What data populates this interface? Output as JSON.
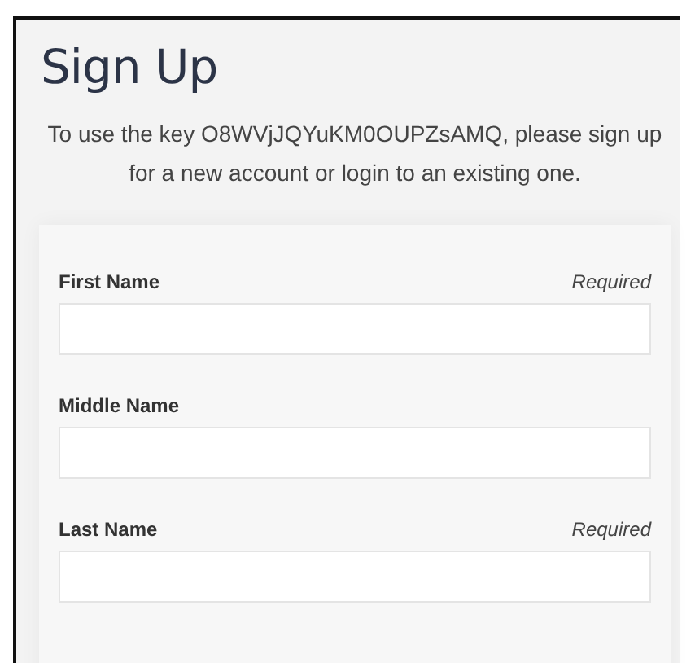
{
  "title": "Sign Up",
  "intro": "To use the key O8WVjJQYuKM0OUPZsAMQ, please sign up for a new account or login to an existing one.",
  "fields": [
    {
      "label": "First Name",
      "note": "Required"
    },
    {
      "label": "Middle Name"
    },
    {
      "label": "Last Name",
      "note": "Required"
    }
  ]
}
